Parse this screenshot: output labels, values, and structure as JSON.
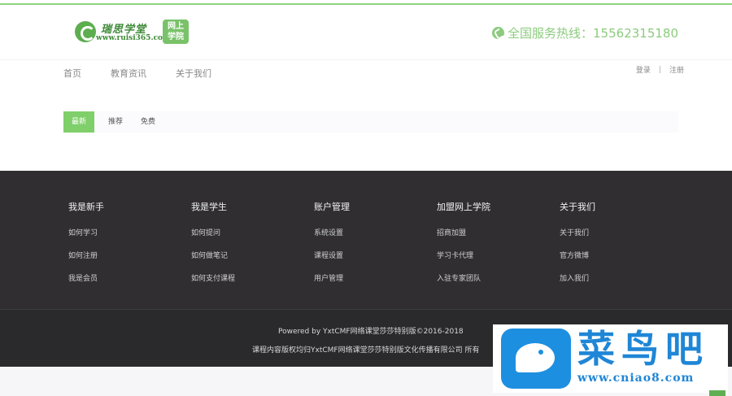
{
  "header": {
    "logo": {
      "name": "瑞思学堂",
      "url": "www.ruisi365.com",
      "badge_line1": "网上",
      "badge_line2": "学院"
    },
    "hotline": "全国服务热线：15562315180"
  },
  "nav": {
    "items": [
      "首页",
      "教育资讯",
      "关于我们"
    ]
  },
  "auth": {
    "login": "登录",
    "separator": "|",
    "register": "注册"
  },
  "tabs": {
    "items": [
      "最新",
      "推荐",
      "免费"
    ],
    "active_index": 0
  },
  "footer": {
    "columns": [
      {
        "title": "我是新手",
        "links": [
          "如何学习",
          "如何注册",
          "我是会员"
        ]
      },
      {
        "title": "我是学生",
        "links": [
          "如何提问",
          "如何做笔记",
          "如何支付课程"
        ]
      },
      {
        "title": "账户管理",
        "links": [
          "系统设置",
          "课程设置",
          "用户管理"
        ]
      },
      {
        "title": "加盟网上学院",
        "links": [
          "招商加盟",
          "学习卡代理",
          "入驻专家团队"
        ]
      },
      {
        "title": "关于我们",
        "links": [
          "关于我们",
          "官方微博",
          "加入我们"
        ]
      }
    ],
    "powered": "Powered by YxtCMF网络课堂莎莎特别版©2016-2018",
    "rights": "课程内容版权均归YxtCMF网络课堂莎莎特别版文化传播有限公司 所有"
  },
  "watermark": {
    "title": "菜鸟吧",
    "url": "www.cniao8.com"
  },
  "colors": {
    "accent_green": "#7fcf6a",
    "footer_bg": "#302e31",
    "watermark_blue": "#1f86d6"
  }
}
